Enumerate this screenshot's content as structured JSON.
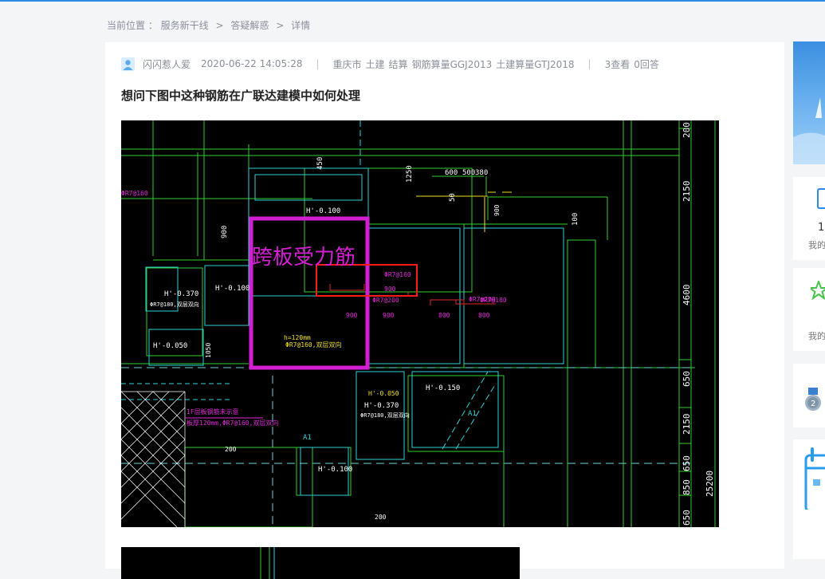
{
  "breadcrumb": {
    "prefix": "当前位置 ：",
    "items": [
      "服务新干线",
      "答疑解惑",
      "详情"
    ],
    "separator": ">"
  },
  "question": {
    "author": "闪闪惹人爱",
    "datetime": "2020-06-22 14:05:28",
    "location": "重庆市",
    "tags": [
      "土建",
      "结算",
      "钢筋算量GGJ2013",
      "土建算量GTJ2018"
    ],
    "views": "3查看",
    "answers": "0回答",
    "title": "想问下图中这种钢筋在广联达建模中如何处理"
  },
  "drawing": {
    "annotation": "跨板受力筋",
    "dims_top": [
      "450",
      "1250",
      "600",
      "500",
      "380",
      "50",
      "900",
      "100"
    ],
    "dims_right": [
      "200",
      "2150",
      "4600",
      "650",
      "2150",
      "650",
      "850",
      "25200",
      "650"
    ],
    "room_labels": [
      "H'-0.100",
      "H'-0.370",
      "H'-0.100",
      "H'-0.050",
      "H'-0.150",
      "H'-0.370",
      "H'-0.050",
      "H'-0.100"
    ],
    "room_rebar": [
      "ΦR7@180,双层双向",
      "ΦR7@180,双层双向"
    ],
    "slab_label": "h=120mm",
    "slab_rebar": "ΦR7@160,双层双向",
    "rebar_labels": [
      "ΦR7@160",
      "ΦR7@160",
      "ΦR7@200",
      "ΦR7@200",
      "ΦR7@180"
    ],
    "rebar_lengths": [
      "900",
      "900",
      "900",
      "800",
      "800"
    ],
    "left_notes": [
      "1F层板钢筋未示意",
      "板厚120mm,ΦR7@160,双层双向"
    ],
    "misc_labels": [
      "A1",
      "A1",
      "200",
      "200",
      "1050",
      "900"
    ]
  },
  "sidebar": {
    "count": "1",
    "labels": [
      "我的",
      "我的"
    ]
  },
  "colors": {
    "accent": "#2a8ae4",
    "annotation": "#d21fd2",
    "highlight_box": "#ff1a1a"
  }
}
